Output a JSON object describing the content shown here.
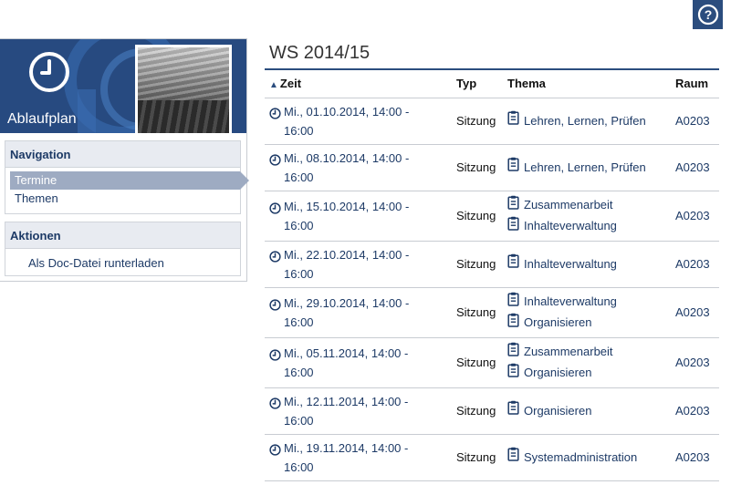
{
  "help": {
    "icon": "question-circle-icon",
    "label": "?"
  },
  "sidebar": {
    "title": "Ablaufplan",
    "header_icon": "clock-icon",
    "navigation": {
      "heading": "Navigation",
      "items": [
        {
          "label": "Termine",
          "active": true
        },
        {
          "label": "Themen",
          "active": false
        }
      ]
    },
    "actions": {
      "heading": "Aktionen",
      "items": [
        {
          "label": "Als Doc-Datei runterladen"
        }
      ]
    }
  },
  "main": {
    "title": "WS 2014/15",
    "table": {
      "columns": [
        "Zeit",
        "Typ",
        "Thema",
        "Raum"
      ],
      "rows": [
        {
          "zeit": [
            "Mi., 01.10.2014, 14:00 -",
            "16:00"
          ],
          "typ": "Sitzung",
          "themen": [
            "Lehren, Lernen, Prüfen"
          ],
          "raum": "A0203"
        },
        {
          "zeit": [
            "Mi., 08.10.2014, 14:00 -",
            "16:00"
          ],
          "typ": "Sitzung",
          "themen": [
            "Lehren, Lernen, Prüfen"
          ],
          "raum": "A0203"
        },
        {
          "zeit": [
            "Mi., 15.10.2014, 14:00 -",
            "16:00"
          ],
          "typ": "Sitzung",
          "themen": [
            "Zusammenarbeit",
            "Inhalteverwaltung"
          ],
          "raum": "A0203"
        },
        {
          "zeit": [
            "Mi., 22.10.2014, 14:00 -",
            "16:00"
          ],
          "typ": "Sitzung",
          "themen": [
            "Inhalteverwaltung"
          ],
          "raum": "A0203"
        },
        {
          "zeit": [
            "Mi., 29.10.2014, 14:00 -",
            "16:00"
          ],
          "typ": "Sitzung",
          "themen": [
            "Inhalteverwaltung",
            "Organisieren"
          ],
          "raum": "A0203"
        },
        {
          "zeit": [
            "Mi., 05.11.2014, 14:00 -",
            "16:00"
          ],
          "typ": "Sitzung",
          "themen": [
            "Zusammenarbeit",
            "Organisieren"
          ],
          "raum": "A0203"
        },
        {
          "zeit": [
            "Mi., 12.11.2014, 14:00 -",
            "16:00"
          ],
          "typ": "Sitzung",
          "themen": [
            "Organisieren"
          ],
          "raum": "A0203"
        },
        {
          "zeit": [
            "Mi., 19.11.2014, 14:00 -",
            "16:00"
          ],
          "typ": "Sitzung",
          "themen": [
            "Systemadministration"
          ],
          "raum": "A0203"
        }
      ]
    }
  },
  "colors": {
    "accent": "#2b4d7e",
    "link": "#1d3a66",
    "active_nav": "#9eabc2",
    "box_header": "#e8ebf1"
  }
}
